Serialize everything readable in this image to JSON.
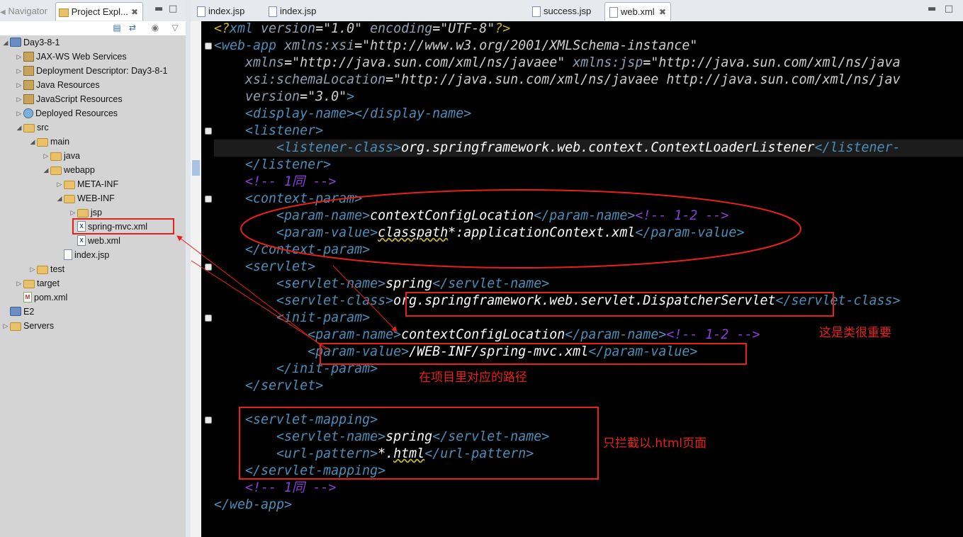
{
  "left_panel": {
    "tabs": [
      {
        "label": "Navigator"
      },
      {
        "label": "Project Expl..."
      }
    ],
    "tree": [
      {
        "label": "Day3-8-1",
        "depth": 0,
        "icon": "project-icon",
        "arrow": "expanded"
      },
      {
        "label": "JAX-WS Web Services",
        "depth": 1,
        "icon": "jaxws-icon",
        "arrow": "collapsed"
      },
      {
        "label": "Deployment Descriptor: Day3-8-1",
        "depth": 1,
        "icon": "descriptor-icon",
        "arrow": "collapsed"
      },
      {
        "label": "Java Resources",
        "depth": 1,
        "icon": "java-resources-icon",
        "arrow": "collapsed"
      },
      {
        "label": "JavaScript Resources",
        "depth": 1,
        "icon": "javascript-resources-icon",
        "arrow": "collapsed"
      },
      {
        "label": "Deployed Resources",
        "depth": 1,
        "icon": "deployed-resources-icon",
        "arrow": "collapsed"
      },
      {
        "label": "src",
        "depth": 1,
        "icon": "folder-icon",
        "arrow": "expanded"
      },
      {
        "label": "main",
        "depth": 2,
        "icon": "folder-icon",
        "arrow": "expanded"
      },
      {
        "label": "java",
        "depth": 3,
        "icon": "folder-icon",
        "arrow": "collapsed"
      },
      {
        "label": "webapp",
        "depth": 3,
        "icon": "folder-icon",
        "arrow": "expanded"
      },
      {
        "label": "META-INF",
        "depth": 4,
        "icon": "folder-icon",
        "arrow": "collapsed"
      },
      {
        "label": "WEB-INF",
        "depth": 4,
        "icon": "folder-icon",
        "arrow": "expanded"
      },
      {
        "label": "jsp",
        "depth": 5,
        "icon": "folder-icon",
        "arrow": "collapsed"
      },
      {
        "label": "spring-mvc.xml",
        "depth": 5,
        "icon": "xml-file-icon",
        "arrow": "none"
      },
      {
        "label": "web.xml",
        "depth": 5,
        "icon": "xml-file-icon",
        "arrow": "none"
      },
      {
        "label": "index.jsp",
        "depth": 4,
        "icon": "jsp-file-icon",
        "arrow": "none"
      },
      {
        "label": "test",
        "depth": 2,
        "icon": "folder-icon",
        "arrow": "collapsed"
      },
      {
        "label": "target",
        "depth": 1,
        "icon": "folder-icon",
        "arrow": "collapsed"
      },
      {
        "label": "pom.xml",
        "depth": 1,
        "icon": "maven-file-icon",
        "arrow": "none"
      },
      {
        "label": "E2",
        "depth": 0,
        "icon": "project-icon",
        "arrow": "none"
      },
      {
        "label": "Servers",
        "depth": 0,
        "icon": "folder-icon",
        "arrow": "collapsed"
      }
    ]
  },
  "editor": {
    "tabs": [
      {
        "label": "index.jsp",
        "active": false
      },
      {
        "label": "index.jsp",
        "active": false
      },
      {
        "label": "success.jsp",
        "active": false
      },
      {
        "label": "web.xml",
        "active": true
      }
    ],
    "lines": [
      [
        [
          "pi",
          "<?"
        ],
        [
          "tag",
          "xml"
        ],
        [
          "at",
          " version"
        ],
        [
          "tx",
          "="
        ],
        [
          "av",
          "\"1.0\""
        ],
        [
          "at",
          " encoding"
        ],
        [
          "tx",
          "="
        ],
        [
          "av",
          "\"UTF-8\""
        ],
        [
          "pi",
          "?>"
        ]
      ],
      [
        [
          "tag",
          "<web-app"
        ],
        [
          "at",
          " xmlns:xsi"
        ],
        [
          "tx",
          "="
        ],
        [
          "av",
          "\"http://www.w3.org/2001/XMLSchema-instance\""
        ]
      ],
      [
        [
          "at",
          "    xmlns"
        ],
        [
          "tx",
          "="
        ],
        [
          "av",
          "\"http://java.sun.com/xml/ns/javaee\""
        ],
        [
          "at",
          " xmlns:jsp"
        ],
        [
          "tx",
          "="
        ],
        [
          "av",
          "\"http://java.sun.com/xml/ns/java"
        ]
      ],
      [
        [
          "at",
          "    xsi:schemaLocation"
        ],
        [
          "tx",
          "="
        ],
        [
          "av",
          "\"http://java.sun.com/xml/ns/javaee http://java.sun.com/xml/ns/jav"
        ]
      ],
      [
        [
          "at",
          "    version"
        ],
        [
          "tx",
          "="
        ],
        [
          "av",
          "\"3.0\""
        ],
        [
          "tag",
          ">"
        ]
      ],
      [
        [
          "tag",
          "    <display-name></display-name>"
        ]
      ],
      [
        [
          "tag",
          "    <listener>"
        ]
      ],
      [
        [
          "tag",
          "        <listener-class>"
        ],
        [
          "tx",
          "org.springframework.web.context.ContextLoaderListener"
        ],
        [
          "tag",
          "</listener-"
        ]
      ],
      [
        [
          "tag",
          "    </listener>"
        ]
      ],
      [
        [
          "cm",
          "    <!-- 1同 -->"
        ]
      ],
      [
        [
          "tag",
          "    <context-param>"
        ]
      ],
      [
        [
          "tag",
          "        <param-name>"
        ],
        [
          "tx",
          "contextConfigLocation"
        ],
        [
          "tag",
          "</param-name>"
        ],
        [
          "cm",
          "<!-- 1-2 -->"
        ]
      ],
      [
        [
          "tag",
          "        <param-value>"
        ],
        [
          "tx",
          "classpath"
        ],
        [
          "tx",
          "*:applicationContext.xml"
        ],
        [
          "tag",
          "</param-value>"
        ]
      ],
      [
        [
          "tag",
          "    </context-param>"
        ]
      ],
      [
        [
          "tag",
          "    <servlet>"
        ]
      ],
      [
        [
          "tag",
          "        <servlet-name>"
        ],
        [
          "tx",
          "spring"
        ],
        [
          "tag",
          "</servlet-name>"
        ]
      ],
      [
        [
          "tag",
          "        <servlet-class>"
        ],
        [
          "tx",
          "org.springframework.web.servlet.DispatcherServlet"
        ],
        [
          "tag",
          "</servlet-class>"
        ]
      ],
      [
        [
          "tag",
          "        <init-param>"
        ]
      ],
      [
        [
          "tag",
          "            <param-name>"
        ],
        [
          "tx",
          "contextConfigLocation"
        ],
        [
          "tag",
          "</param-name>"
        ],
        [
          "cm",
          "<!-- 1-2 -->"
        ]
      ],
      [
        [
          "tag",
          "            <param-value>"
        ],
        [
          "tx",
          "/WEB-INF/spring-mvc.xml"
        ],
        [
          "tag",
          "</param-value>"
        ]
      ],
      [
        [
          "tag",
          "        </init-param>"
        ]
      ],
      [
        [
          "tag",
          "    </servlet>"
        ]
      ],
      [
        [
          "tx",
          ""
        ]
      ],
      [
        [
          "tag",
          "    <servlet-mapping>"
        ]
      ],
      [
        [
          "tag",
          "        <servlet-name>"
        ],
        [
          "tx",
          "spring"
        ],
        [
          "tag",
          "</servlet-name>"
        ]
      ],
      [
        [
          "tag",
          "        <url-pattern>"
        ],
        [
          "tx",
          "*."
        ],
        [
          "tx",
          "html"
        ],
        [
          "tag",
          "</url-pattern>"
        ]
      ],
      [
        [
          "tag",
          "    </servlet-mapping>"
        ]
      ],
      [
        [
          "cm",
          "    <!-- 1同 -->"
        ]
      ],
      [
        [
          "tag",
          "</web-app>"
        ]
      ]
    ]
  },
  "annotations": {
    "important_note": "这是类很重要",
    "path_note": "在项目里对应的路径",
    "html_note": "只拦截以.html页面"
  },
  "colors": {
    "editor_bg": "#000000",
    "tag": "#4b8fb8",
    "comment": "#8a3fd6",
    "annotation": "#e8201c"
  }
}
